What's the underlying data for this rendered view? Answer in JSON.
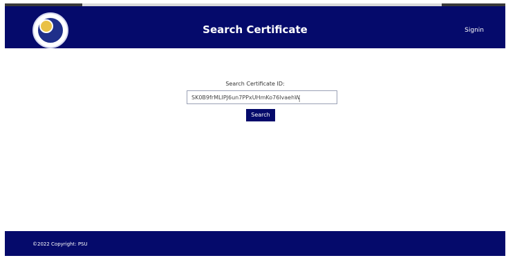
{
  "header": {
    "title": "Search Certificate",
    "signin_label": "Signin",
    "logo_icon": "university-seal-icon"
  },
  "search": {
    "label": "Search Certificate ID:",
    "value": "SK0B9frMLIPJ6un7PPxUHmKo76lvaehW",
    "button_label": "Search"
  },
  "footer": {
    "copyright": "©2022 Copyright: PSU"
  },
  "colors": {
    "primary": "#050a6b",
    "background": "#ffffff"
  }
}
